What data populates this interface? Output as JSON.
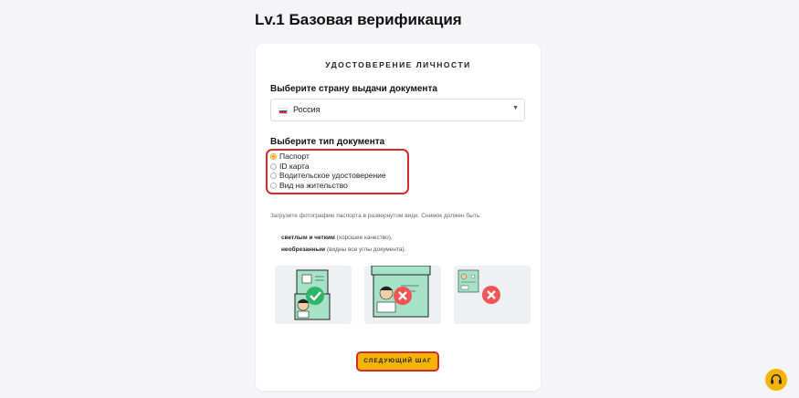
{
  "page": {
    "title": "Lv.1 Базовая верификация"
  },
  "card": {
    "section_title": "УДОСТОВЕРЕНИЕ ЛИЧНОСТИ",
    "country": {
      "label": "Выберите страну выдачи документа",
      "selected": "Россия",
      "flag_colors": [
        "#ffffff",
        "#2a52be",
        "#e0282e"
      ]
    },
    "doc_type": {
      "label": "Выберите тип документа",
      "options": [
        {
          "label": "Паспорт",
          "selected": true
        },
        {
          "label": "ID карта",
          "selected": false
        },
        {
          "label": "Водительское удостоверение",
          "selected": false
        },
        {
          "label": "Вид на жительство",
          "selected": false
        }
      ]
    },
    "instructions": "Загрузите фотографию паспорта в развернутом виде. Снимок должен быть:",
    "requirements": [
      {
        "bold": "светлым и четким",
        "rest": " (хорошее качество),"
      },
      {
        "bold": "необрезанным",
        "rest": " (видны все углы документа)."
      }
    ],
    "examples": [
      {
        "name": "correct-example",
        "status": "correct"
      },
      {
        "name": "cropped-example",
        "status": "wrong"
      },
      {
        "name": "small-example",
        "status": "wrong"
      }
    ],
    "next_button": "СЛЕДУЮЩИЙ ШАГ"
  },
  "colors": {
    "accent": "#f4b400",
    "highlight_border": "#d62b2b",
    "success": "#2fb56a",
    "error": "#ee5656",
    "doc_green": "#a6e2c8"
  },
  "icons": {
    "support": "headset-icon",
    "dropdown": "chevron-down-icon"
  }
}
